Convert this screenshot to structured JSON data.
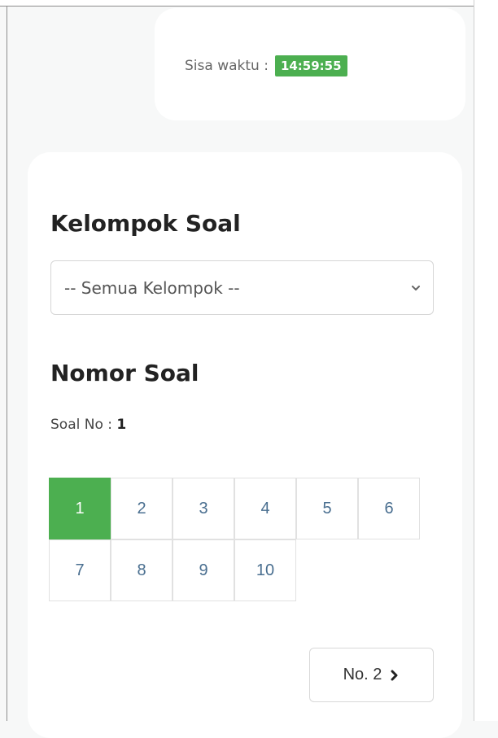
{
  "timer": {
    "label": "Sisa waktu :",
    "remaining": "14:59:55"
  },
  "group_section": {
    "title": "Kelompok Soal",
    "selected": "-- Semua Kelompok --"
  },
  "number_section": {
    "title": "Nomor Soal",
    "current_label": "Soal No :",
    "current_number": "1",
    "numbers": [
      "1",
      "2",
      "3",
      "4",
      "5",
      "6",
      "7",
      "8",
      "9",
      "10"
    ],
    "active_number": "1"
  },
  "navigation": {
    "next_label": "No. 2"
  },
  "colors": {
    "accent": "#4caf50",
    "number_text": "#4a6f90"
  }
}
